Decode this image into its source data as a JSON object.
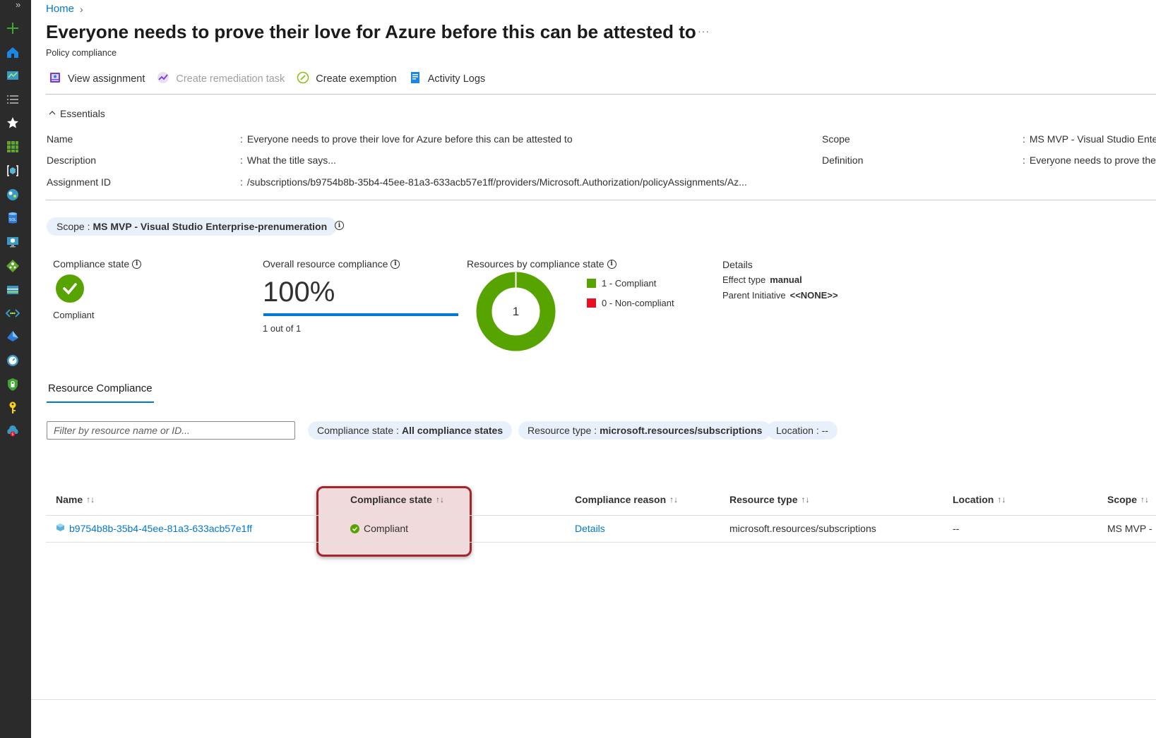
{
  "nav_rail": {
    "expand_label": "»",
    "icons": [
      "plus-icon",
      "home-icon",
      "dashboard-icon",
      "all-services-icon",
      "favorites-star-icon",
      "all-resources-icon",
      "resource-group-icon",
      "app-services-icon",
      "sql-database-icon",
      "virtual-machine-icon",
      "load-balancer-icon",
      "storage-account-icon",
      "virtual-network-icon",
      "entra-id-icon",
      "monitor-icon",
      "defender-icon",
      "key-vault-icon",
      "cost-management-icon"
    ]
  },
  "breadcrumb": {
    "home": "Home"
  },
  "header": {
    "title": "Everyone needs to prove their love for Azure before this can be attested to",
    "more": "···",
    "subtitle": "Policy compliance"
  },
  "toolbar": {
    "view_assignment": "View assignment",
    "create_remediation": "Create remediation task",
    "create_exemption": "Create exemption",
    "activity_logs": "Activity Logs"
  },
  "essentials": {
    "toggle": "Essentials",
    "name_label": "Name",
    "name_value": "Everyone needs to prove their love for Azure before this can be attested to",
    "description_label": "Description",
    "description_value": "What the title says...",
    "assignment_id_label": "Assignment ID",
    "assignment_id_value": "/subscriptions/b9754b8b-35b4-45ee-81a3-633acb57e1ff/providers/Microsoft.Authorization/policyAssignments/Az...",
    "scope_label": "Scope",
    "scope_value": "MS MVP - Visual Studio Ente",
    "definition_label": "Definition",
    "definition_value": "Everyone needs to prove the",
    "colon": ":"
  },
  "scope_pill": {
    "prefix": "Scope :",
    "value": "MS MVP - Visual Studio Enterprise-prenumeration"
  },
  "summary": {
    "compliance_state_label": "Compliance state",
    "compliance_state_value": "Compliant",
    "overall_label": "Overall resource compliance",
    "overall_percent": "100%",
    "overall_fraction": 1.0,
    "overall_sub": "1 out of 1",
    "by_state_label": "Resources by compliance state",
    "donut_center": "1",
    "legend_compliant": "1 - Compliant",
    "legend_noncompliant": "0 - Non-compliant",
    "compliant_count": 1,
    "noncompliant_count": 0,
    "details_title": "Details",
    "effect_type_label": "Effect type",
    "effect_type_value": "manual",
    "parent_initiative_label": "Parent Initiative",
    "parent_initiative_value": "<<NONE>>",
    "info_glyph": "i"
  },
  "colors": {
    "compliant": "#57a300",
    "noncompliant": "#e81123",
    "accent": "#0078d4",
    "highlight": "#a4262c"
  },
  "tabs": {
    "resource_compliance": "Resource Compliance"
  },
  "filters": {
    "search_placeholder": "Filter by resource name or ID...",
    "compliance_prefix": "Compliance state :",
    "compliance_value": "All compliance states",
    "resource_type_prefix": "Resource type :",
    "resource_type_value": "microsoft.resources/subscriptions",
    "location": "Location : --"
  },
  "table": {
    "sort_glyph": "↑↓",
    "columns": {
      "name": "Name",
      "compliance_state": "Compliance state",
      "compliance_reason": "Compliance reason",
      "resource_type": "Resource type",
      "location": "Location",
      "scope": "Scope"
    },
    "rows": [
      {
        "name": "b9754b8b-35b4-45ee-81a3-633acb57e1ff",
        "compliance_state": "Compliant",
        "compliance_reason": "Details",
        "resource_type": "microsoft.resources/subscriptions",
        "location": "--",
        "scope": "MS MVP -"
      }
    ]
  }
}
